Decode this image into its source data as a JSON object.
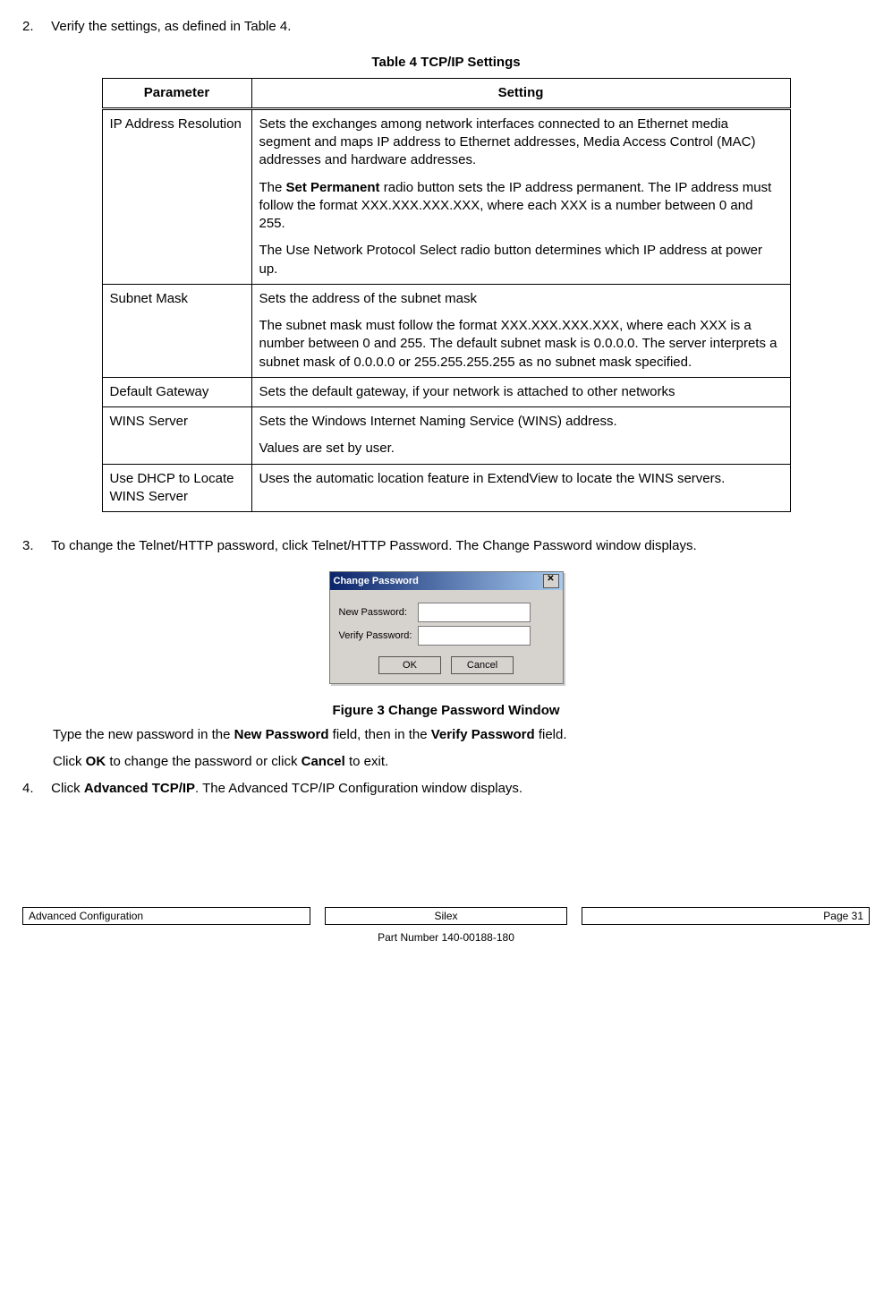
{
  "steps": {
    "s2": {
      "num": "2.",
      "text": "Verify the settings, as defined in Table 4."
    },
    "s3": {
      "num": "3.",
      "text": "To change the Telnet/HTTP password, click Telnet/HTTP Password. The Change Password window displays."
    },
    "s4": {
      "num": "4."
    }
  },
  "table4": {
    "caption": "Table 4  TCP/IP Settings",
    "headers": {
      "p": "Parameter",
      "s": "Setting"
    },
    "rows": [
      {
        "param": "IP Address Resolution",
        "p1": "Sets the exchanges among network interfaces connected to an Ethernet media segment and maps IP address to Ethernet addresses, Media Access Control (MAC) addresses and hardware addresses.",
        "p2a": "The ",
        "p2b": "Set Permanent",
        "p2c": " radio button sets the IP address permanent. The IP address must follow the format XXX.XXX.XXX.XXX, where each XXX is a number between 0 and 255.",
        "p3": "The Use Network Protocol Select radio button determines which IP address at power up."
      },
      {
        "param": "Subnet Mask",
        "p1": "Sets the address of the subnet mask",
        "p2": "The subnet mask must follow the format XXX.XXX.XXX.XXX, where each XXX is a number between 0 and 255. The default subnet mask is 0.0.0.0. The server interprets a subnet mask of 0.0.0.0 or 255.255.255.255 as no subnet mask specified."
      },
      {
        "param": "Default Gateway",
        "p1": "Sets the default gateway, if your network is attached to other networks"
      },
      {
        "param": "WINS Server",
        "p1": "Sets the Windows Internet Naming Service (WINS) address.",
        "p2": "Values are set by user."
      },
      {
        "param": "Use DHCP to Locate WINS Server",
        "p1": "Uses the automatic location feature in ExtendView to locate the WINS servers."
      }
    ]
  },
  "dialog": {
    "title": "Change Password",
    "new_pw": "New Password:",
    "verify_pw": "Verify Password:",
    "ok": "OK",
    "cancel": "Cancel",
    "close": "✕"
  },
  "fig3": "Figure 3  Change Password Window",
  "after_fig": {
    "l1a": "Type the new password in the ",
    "l1b": "New Password",
    "l1c": " field, then in the ",
    "l1d": "Verify Password",
    "l1e": " field.",
    "l2a": "Click ",
    "l2b": "OK",
    "l2c": " to change the password or click ",
    "l2d": "Cancel",
    "l2e": " to exit."
  },
  "step4_line": {
    "a": "Click ",
    "b": "Advanced TCP/IP",
    "c": ". The Advanced TCP/IP Configuration window displays."
  },
  "footer": {
    "left": "Advanced Configuration",
    "center": "Silex",
    "right": "Page 31",
    "part": "Part Number 140-00188-180"
  }
}
